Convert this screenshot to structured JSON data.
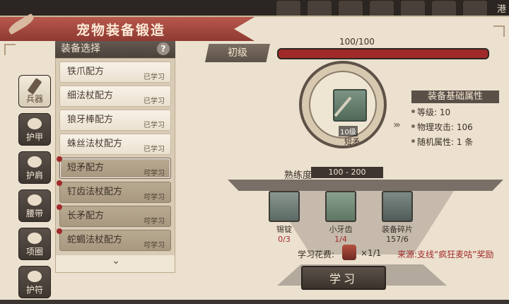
{
  "title": "宠物装备锻造",
  "top_right_label": "港",
  "side_tabs": [
    {
      "label": "兵器",
      "active": true
    },
    {
      "label": "护甲",
      "active": false
    },
    {
      "label": "护肩",
      "active": false
    },
    {
      "label": "腰带",
      "active": false
    },
    {
      "label": "项圈",
      "active": false
    },
    {
      "label": "护符",
      "active": false
    }
  ],
  "list": {
    "header": "装备选择",
    "help": "?",
    "items": [
      {
        "name": "铁爪配方",
        "status": "已学习"
      },
      {
        "name": "细法杖配方",
        "status": "已学习"
      },
      {
        "name": "狼牙棒配方",
        "status": "已学习"
      },
      {
        "name": "蛛丝法杖配方",
        "status": "已学习"
      },
      {
        "name": "短矛配方",
        "status": "可学习"
      },
      {
        "name": "钉齿法杖配方",
        "status": "可学习"
      },
      {
        "name": "长矛配方",
        "status": "可学习"
      },
      {
        "name": "蛇蝎法杖配方",
        "status": "可学习"
      }
    ],
    "scroll_down": "⌄"
  },
  "grade": "初级",
  "progress": {
    "text": "100/100",
    "fraction": 1.0
  },
  "weapon": {
    "level": "10级",
    "name": "短矛"
  },
  "attrs": {
    "header": "装备基础属性",
    "lines": [
      "等级: 10",
      "物理攻击: 106",
      "随机属性: 1 条"
    ]
  },
  "proficiency": {
    "label": "熟练度",
    "range": "100 - 200"
  },
  "materials": [
    {
      "name": "锡锭",
      "count": "0/3",
      "short": true
    },
    {
      "name": "小牙齿",
      "count": "1/4",
      "short": true
    },
    {
      "name": "装备碎片",
      "count": "157/6",
      "short": false
    }
  ],
  "cost": {
    "label": "学习花费:",
    "value": "×1/1"
  },
  "source": "来源:支线“疯狂麦咕”奖励",
  "learn_button": "学习",
  "colors": {
    "accent_red": "#a02a2a",
    "dark_panel": "#4b423b",
    "paper": "#ece1cf"
  }
}
